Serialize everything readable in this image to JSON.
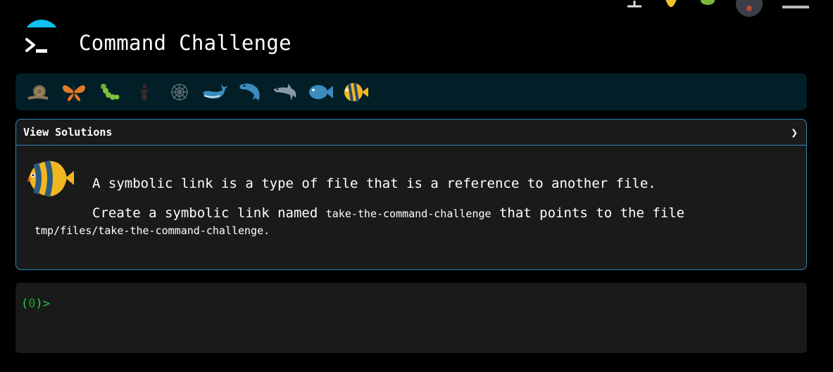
{
  "header": {
    "title": "Command Challenge",
    "logo_icon": "terminal-prompt-icon"
  },
  "topnav": {
    "icons": [
      "sort-icon",
      "trophy-icon",
      "bug-icon",
      "user-avatar",
      "menu-icon"
    ]
  },
  "levels": [
    {
      "name": "snail",
      "icon": "snail-icon"
    },
    {
      "name": "butterfly",
      "icon": "butterfly-icon"
    },
    {
      "name": "caterpillar",
      "icon": "caterpillar-icon"
    },
    {
      "name": "ant",
      "icon": "ant-icon"
    },
    {
      "name": "spider-web",
      "icon": "spider-web-icon"
    },
    {
      "name": "whale",
      "icon": "whale-icon"
    },
    {
      "name": "blue-dolphin",
      "icon": "dolphin-icon"
    },
    {
      "name": "grey-dolphin",
      "icon": "dolphin-grey-icon"
    },
    {
      "name": "fish",
      "icon": "fish-icon"
    },
    {
      "name": "tropical-fish",
      "icon": "tropical-fish-icon"
    }
  ],
  "panel": {
    "title": "View Solutions",
    "chevron": "❯",
    "line1": "A symbolic link is a type of file that is a reference to another file.",
    "line2_prefix": "Create a symbolic link named ",
    "line2_code": "take-the-command-challenge",
    "line2_suffix": " that points to the file",
    "line3": "tmp/files/take-the-command-challenge."
  },
  "terminal": {
    "prompt_open": "(",
    "prompt_count": "0",
    "prompt_close": ")>"
  },
  "colors": {
    "accent": "#0fc0f0",
    "panel_border": "#2e88b8",
    "level_bg": "#021e27",
    "prompt": "#1fcf3a"
  }
}
